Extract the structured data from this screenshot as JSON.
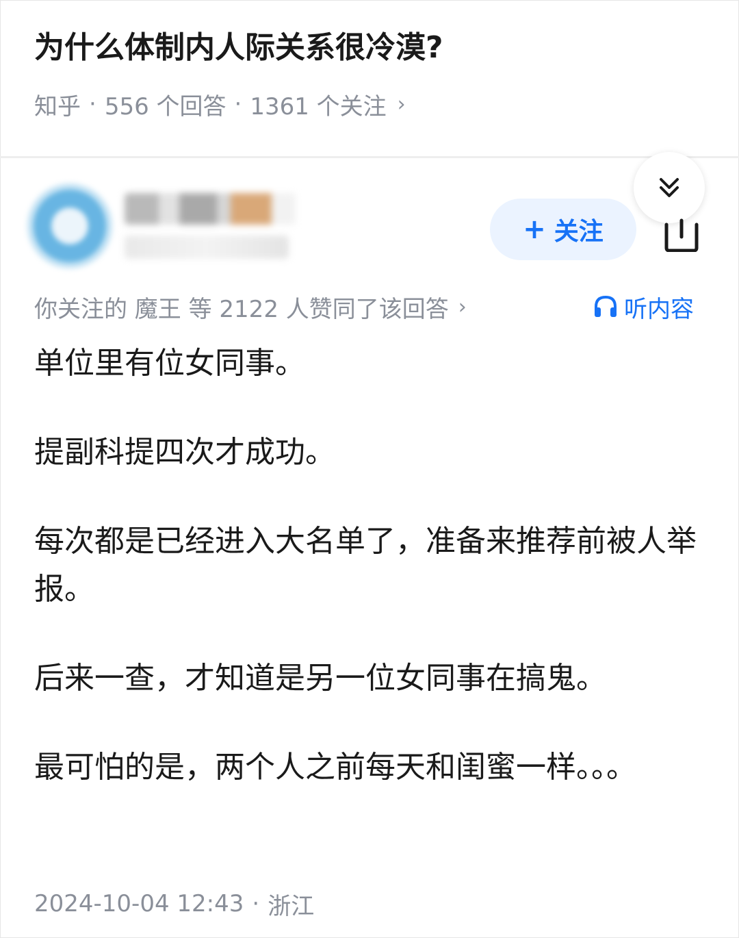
{
  "question": {
    "title": "为什么体制内人际关系很冷漠?",
    "source": "知乎",
    "answers": "556 个回答",
    "followers": "1361 个关注",
    "chevron": "›"
  },
  "author": {
    "follow_label": "关注",
    "follow_icon": "plus-icon"
  },
  "endorsement": {
    "text": "你关注的 魔王 等 2122 人赞同了该回答",
    "chevron": "›"
  },
  "listen": {
    "label": "听内容"
  },
  "answer": {
    "paragraphs": [
      "单位里有位女同事。",
      "提副科提四次才成功。",
      "每次都是已经进入大名单了，准备来推荐前被人举报。",
      "后来一查，才知道是另一位女同事在搞鬼。",
      "最可怕的是，两个人之前每天和闺蜜一样。。。"
    ]
  },
  "footer": {
    "datetime": "2024-10-04 12:43",
    "location": "浙江"
  },
  "colors": {
    "accent": "#1772f6",
    "meta": "#8a8f99",
    "follow_bg": "#ebf3ff"
  }
}
